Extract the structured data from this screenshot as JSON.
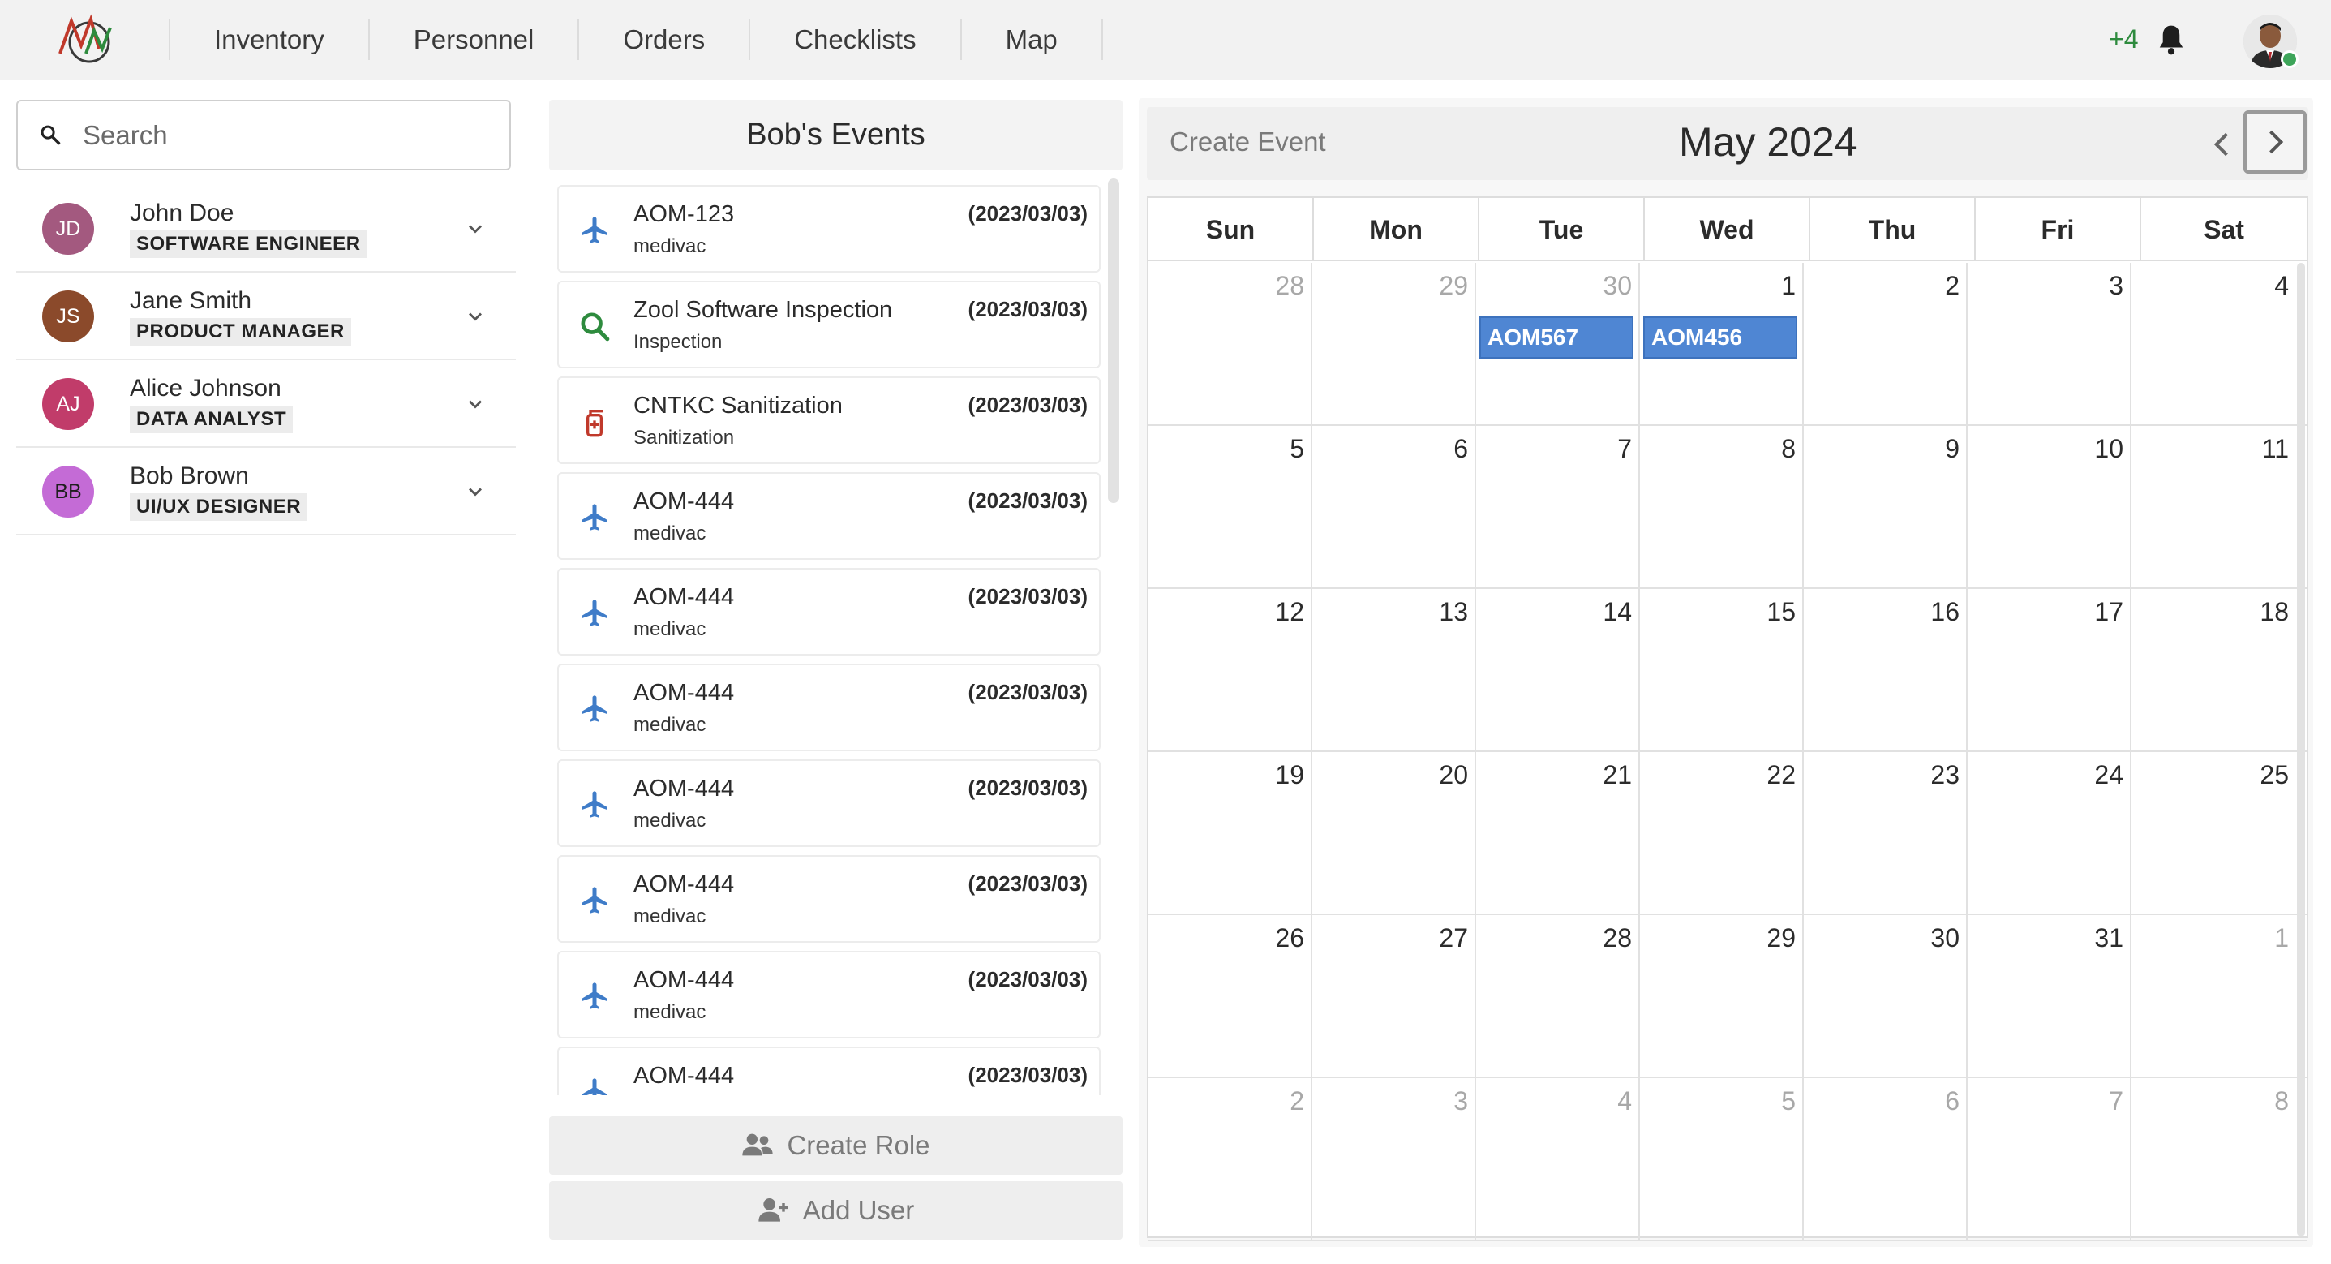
{
  "nav": {
    "items": [
      "Inventory",
      "Personnel",
      "Orders",
      "Checklists",
      "Map"
    ],
    "notification_count": "+4"
  },
  "sidebar": {
    "search_placeholder": "Search",
    "people": [
      {
        "initials": "JD",
        "name": "John Doe",
        "role": "SOFTWARE ENGINEER",
        "color": "#a3597f"
      },
      {
        "initials": "JS",
        "name": "Jane Smith",
        "role": "PRODUCT MANAGER",
        "color": "#8b4a2b"
      },
      {
        "initials": "AJ",
        "name": "Alice Johnson",
        "role": "DATA ANALYST",
        "color": "#c13c6a"
      },
      {
        "initials": "BB",
        "name": "Bob Brown",
        "role": "UI/UX DESIGNER",
        "color": "#c46bd6"
      }
    ]
  },
  "events": {
    "header": "Bob's Events",
    "items": [
      {
        "title": "AOM-123",
        "sub": "medivac",
        "date": "(2023/03/03)",
        "icon": "plane-icon"
      },
      {
        "title": "Zool Software Inspection",
        "sub": "Inspection",
        "date": "(2023/03/03)",
        "icon": "search-icon"
      },
      {
        "title": "CNTKC Sanitization",
        "sub": "Sanitization",
        "date": "(2023/03/03)",
        "icon": "sanitizer-icon"
      },
      {
        "title": "AOM-444",
        "sub": "medivac",
        "date": "(2023/03/03)",
        "icon": "plane-icon"
      },
      {
        "title": "AOM-444",
        "sub": "medivac",
        "date": "(2023/03/03)",
        "icon": "plane-icon"
      },
      {
        "title": "AOM-444",
        "sub": "medivac",
        "date": "(2023/03/03)",
        "icon": "plane-icon"
      },
      {
        "title": "AOM-444",
        "sub": "medivac",
        "date": "(2023/03/03)",
        "icon": "plane-icon"
      },
      {
        "title": "AOM-444",
        "sub": "medivac",
        "date": "(2023/03/03)",
        "icon": "plane-icon"
      },
      {
        "title": "AOM-444",
        "sub": "medivac",
        "date": "(2023/03/03)",
        "icon": "plane-icon"
      },
      {
        "title": "AOM-444",
        "sub": "",
        "date": "(2023/03/03)",
        "icon": "plane-icon"
      }
    ],
    "create_role_label": "Create Role",
    "add_user_label": "Add User"
  },
  "calendar": {
    "create_event_label": "Create Event",
    "month_title": "May 2024",
    "weekdays": [
      "Sun",
      "Mon",
      "Tue",
      "Wed",
      "Thu",
      "Fri",
      "Sat"
    ],
    "weeks": [
      [
        {
          "d": "28",
          "other": true
        },
        {
          "d": "29",
          "other": true
        },
        {
          "d": "30",
          "other": true,
          "event": "AOM567"
        },
        {
          "d": "1",
          "event": "AOM456"
        },
        {
          "d": "2"
        },
        {
          "d": "3"
        },
        {
          "d": "4"
        }
      ],
      [
        {
          "d": "5"
        },
        {
          "d": "6"
        },
        {
          "d": "7"
        },
        {
          "d": "8"
        },
        {
          "d": "9"
        },
        {
          "d": "10"
        },
        {
          "d": "11"
        }
      ],
      [
        {
          "d": "12"
        },
        {
          "d": "13"
        },
        {
          "d": "14"
        },
        {
          "d": "15"
        },
        {
          "d": "16"
        },
        {
          "d": "17"
        },
        {
          "d": "18"
        }
      ],
      [
        {
          "d": "19"
        },
        {
          "d": "20"
        },
        {
          "d": "21"
        },
        {
          "d": "22"
        },
        {
          "d": "23"
        },
        {
          "d": "24"
        },
        {
          "d": "25"
        }
      ],
      [
        {
          "d": "26"
        },
        {
          "d": "27"
        },
        {
          "d": "28"
        },
        {
          "d": "29"
        },
        {
          "d": "30"
        },
        {
          "d": "31"
        },
        {
          "d": "1",
          "other": true
        }
      ],
      [
        {
          "d": "2",
          "other": true
        },
        {
          "d": "3",
          "other": true
        },
        {
          "d": "4",
          "other": true
        },
        {
          "d": "5",
          "other": true
        },
        {
          "d": "6",
          "other": true
        },
        {
          "d": "7",
          "other": true
        },
        {
          "d": "8",
          "other": true
        }
      ]
    ],
    "event_color": "#4f86d3"
  }
}
